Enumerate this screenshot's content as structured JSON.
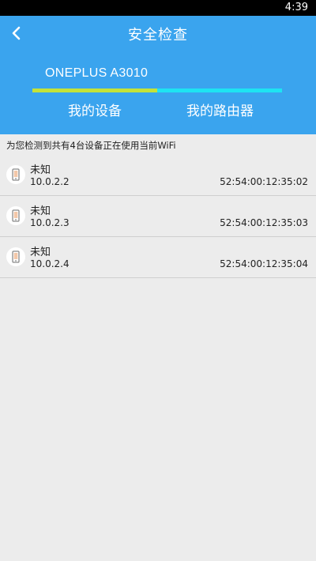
{
  "status_bar": {
    "time": "4:39"
  },
  "header": {
    "title": "安全检查",
    "device_name": "ONEPLUS A3010",
    "progress": 0.5,
    "tabs": [
      {
        "label": "我的设备"
      },
      {
        "label": "我的路由器"
      }
    ]
  },
  "notice": "为您检测到共有4台设备正在使用当前WiFi",
  "devices": [
    {
      "name": "未知",
      "ip": "10.0.2.2",
      "mac": "52:54:00:12:35:02",
      "icon": "phone-icon"
    },
    {
      "name": "未知",
      "ip": "10.0.2.3",
      "mac": "52:54:00:12:35:03",
      "icon": "phone-icon"
    },
    {
      "name": "未知",
      "ip": "10.0.2.4",
      "mac": "52:54:00:12:35:04",
      "icon": "phone-icon"
    }
  ],
  "colors": {
    "header_bg": "#3aa4ee",
    "progress_fill": "#c3e23a",
    "progress_track": "#1ee3f2",
    "page_bg": "#ececec"
  }
}
